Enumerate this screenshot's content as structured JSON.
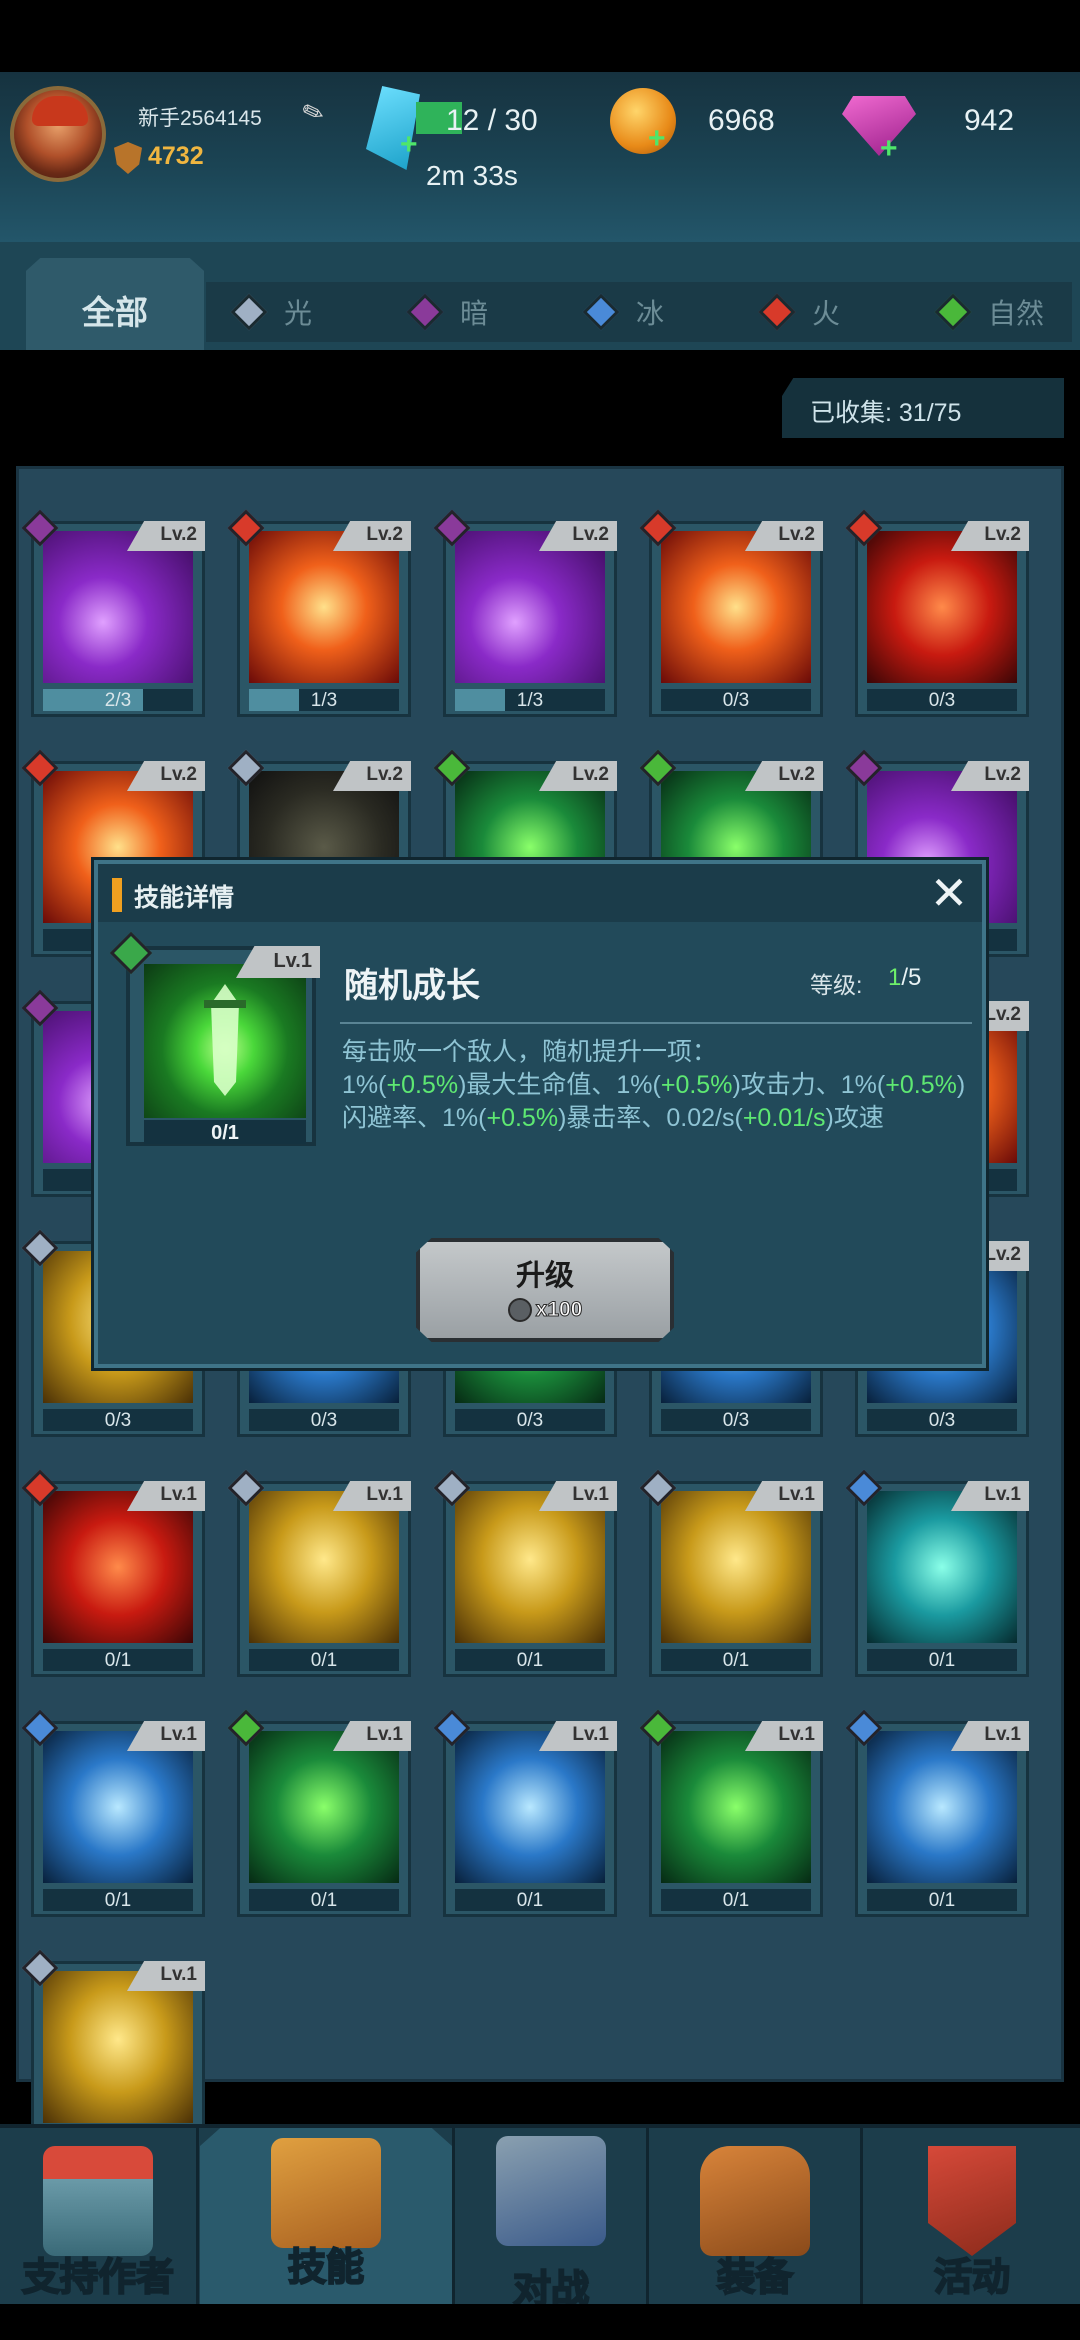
{
  "header": {
    "username": "新手2564145",
    "power": "4732",
    "energy": "12 / 30",
    "energy_timer": "2m 33s",
    "coins": "6968",
    "gems": "942"
  },
  "tabs": [
    {
      "label": "全部",
      "color": "#9fb0b8"
    },
    {
      "label": "光",
      "color": "#9fb0c4"
    },
    {
      "label": "暗",
      "color": "#8a3a9a"
    },
    {
      "label": "冰",
      "color": "#4a8ad8"
    },
    {
      "label": "火",
      "color": "#d83a2a"
    },
    {
      "label": "自然",
      "color": "#4ab83a"
    }
  ],
  "collected": "已收集:  31/75",
  "cards": [
    {
      "lv": "Lv.2",
      "count": "2/3",
      "progress": 0.667,
      "element": "#8a3a9a",
      "art": "purple"
    },
    {
      "lv": "Lv.2",
      "count": "1/3",
      "progress": 0.333,
      "element": "#d83a2a",
      "art": "fire"
    },
    {
      "lv": "Lv.2",
      "count": "1/3",
      "progress": 0.333,
      "element": "#8a3a9a",
      "art": "purple"
    },
    {
      "lv": "Lv.2",
      "count": "0/3",
      "progress": 0,
      "element": "#d83a2a",
      "art": "fire"
    },
    {
      "lv": "Lv.2",
      "count": "0/3",
      "progress": 0,
      "element": "#d83a2a",
      "art": "red"
    },
    {
      "lv": "Lv.2",
      "count": "",
      "progress": 0,
      "element": "#d83a2a",
      "art": "fire"
    },
    {
      "lv": "Lv.2",
      "count": "",
      "progress": 0,
      "element": "#9fb0c4",
      "art": "dark"
    },
    {
      "lv": "Lv.2",
      "count": "",
      "progress": 0,
      "element": "#4ab83a",
      "art": "green"
    },
    {
      "lv": "Lv.2",
      "count": "",
      "progress": 0,
      "element": "#4ab83a",
      "art": "green"
    },
    {
      "lv": "Lv.2",
      "count": "",
      "progress": 0,
      "element": "#8a3a9a",
      "art": "purple"
    },
    {
      "lv": "",
      "count": "",
      "progress": 0,
      "element": "#8a3a9a",
      "art": "purple"
    },
    {
      "lv": "",
      "count": "",
      "progress": 0,
      "element": "#4ab83a",
      "art": "dark"
    },
    {
      "lv": "",
      "count": "",
      "progress": 0,
      "element": "#4ab83a",
      "art": "dark"
    },
    {
      "lv": "",
      "count": "",
      "progress": 0,
      "element": "#4ab83a",
      "art": "dark"
    },
    {
      "lv": "Lv.2",
      "count": "",
      "progress": 0,
      "element": "#d83a2a",
      "art": "fire"
    },
    {
      "lv": "",
      "count": "0/3",
      "progress": 0,
      "element": "#9fb0c4",
      "art": "gold"
    },
    {
      "lv": "",
      "count": "0/3",
      "progress": 0,
      "element": "#4a8ad8",
      "art": "ice"
    },
    {
      "lv": "",
      "count": "0/3",
      "progress": 0,
      "element": "#4ab83a",
      "art": "green"
    },
    {
      "lv": "",
      "count": "0/3",
      "progress": 0,
      "element": "#4a8ad8",
      "art": "ice"
    },
    {
      "lv": "Lv.2",
      "count": "0/3",
      "progress": 0,
      "element": "#4a8ad8",
      "art": "ice"
    },
    {
      "lv": "Lv.1",
      "count": "0/1",
      "progress": 0,
      "element": "#d83a2a",
      "art": "red"
    },
    {
      "lv": "Lv.1",
      "count": "0/1",
      "progress": 0,
      "element": "#9fb0c4",
      "art": "gold"
    },
    {
      "lv": "Lv.1",
      "count": "0/1",
      "progress": 0,
      "element": "#9fb0c4",
      "art": "gold"
    },
    {
      "lv": "Lv.1",
      "count": "0/1",
      "progress": 0,
      "element": "#9fb0c4",
      "art": "gold"
    },
    {
      "lv": "Lv.1",
      "count": "0/1",
      "progress": 0,
      "element": "#4a8ad8",
      "art": "teal"
    },
    {
      "lv": "Lv.1",
      "count": "0/1",
      "progress": 0,
      "element": "#4a8ad8",
      "art": "ice"
    },
    {
      "lv": "Lv.1",
      "count": "0/1",
      "progress": 0,
      "element": "#4ab83a",
      "art": "green"
    },
    {
      "lv": "Lv.1",
      "count": "0/1",
      "progress": 0,
      "element": "#4a8ad8",
      "art": "ice"
    },
    {
      "lv": "Lv.1",
      "count": "0/1",
      "progress": 0,
      "element": "#4ab83a",
      "art": "green"
    },
    {
      "lv": "Lv.1",
      "count": "0/1",
      "progress": 0,
      "element": "#4a8ad8",
      "art": "ice"
    },
    {
      "lv": "Lv.1",
      "count": "",
      "progress": 0,
      "element": "#9fb0c4",
      "art": "gold"
    }
  ],
  "modal": {
    "header": "技能详情",
    "close": "✕",
    "card_lv": "Lv.1",
    "card_count": "0/1",
    "skill_name": "随机成长",
    "level_label": "等级:",
    "level_current": "1",
    "level_max": "/5",
    "desc_line1": "每击败一个敌人，随机提升一项：",
    "desc_parts": [
      "1%(",
      "+0.5%",
      ")最大生命值、1%(",
      "+0.5%",
      ")攻击力、1%(",
      "+0.5%",
      ")闪避率、1%(",
      "+0.5%",
      ")暴击率、0.02/s(",
      "+0.01/s",
      ")攻速"
    ],
    "upgrade_label": "升级",
    "upgrade_cost": "x100"
  },
  "nav": [
    {
      "label": "支持作者",
      "icon": "shop-icon"
    },
    {
      "label": "技能",
      "icon": "skill-book-icon"
    },
    {
      "label": "对战",
      "icon": "crossed-swords-icon"
    },
    {
      "label": "装备",
      "icon": "backpack-icon"
    },
    {
      "label": "活动",
      "icon": "star-badge-icon"
    }
  ]
}
